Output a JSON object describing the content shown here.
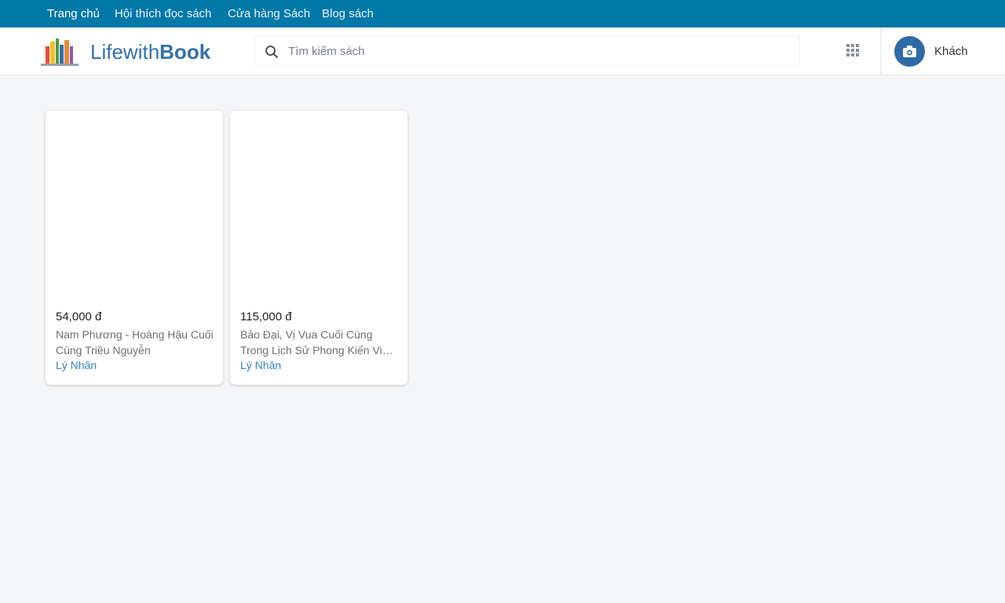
{
  "top_nav": {
    "items": [
      {
        "label": "Trang chủ",
        "active": true
      },
      {
        "label": "Hội thích đọc sách",
        "active": false
      },
      {
        "label": "Cửa hàng Sách",
        "active": false
      },
      {
        "label": "Blog sách",
        "active": false
      }
    ]
  },
  "header": {
    "logo_icon": "books-icon",
    "logo_text_light": "Lifewith",
    "logo_text_bold": "Book",
    "search_placeholder": "Tìm kiếm sách",
    "search_value": "",
    "apps_icon": "grid-icon",
    "user_avatar_icon": "camera-icon",
    "user_name": "Khách"
  },
  "books": [
    {
      "price": "54,000 đ",
      "title": "Nam Phương - Hoàng Hậu Cuối Cùng Triều Nguyễn",
      "author": "Lý Nhân"
    },
    {
      "price": "115,000 đ",
      "title": "Bảo Đại, Vị Vua Cuối Cùng Trong Lịch Sử Phong Kiến Việt Nam",
      "author": "Lý Nhân"
    }
  ],
  "colors": {
    "nav_bg": "#0078a8",
    "brand": "#2f72ad",
    "author_link": "#3a82c8",
    "page_bg": "#f5f6f8"
  }
}
